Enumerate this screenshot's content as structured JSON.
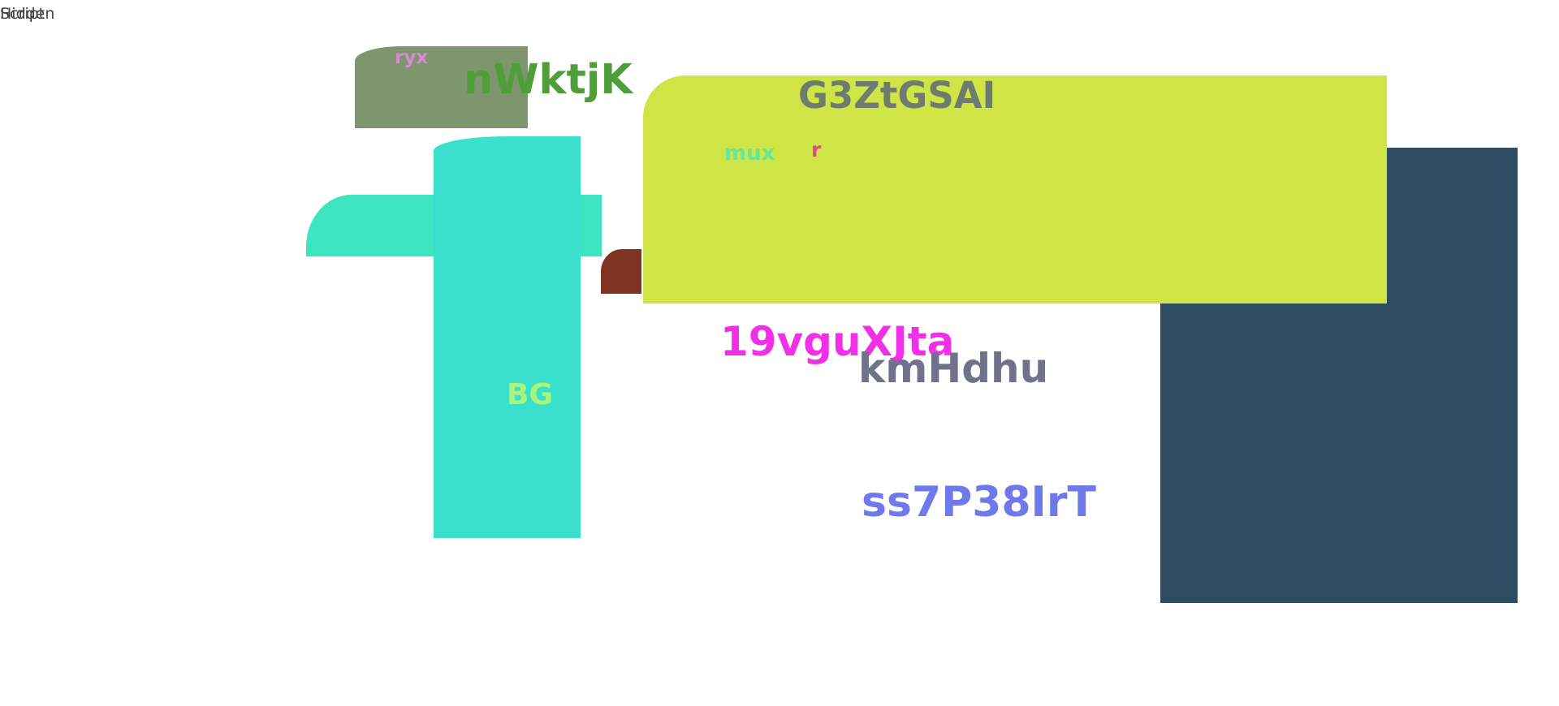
{
  "corner_labels": [
    "Hidden",
    "Script"
  ],
  "shapes": [
    {
      "name": "olive-block",
      "color": "#7e966d"
    },
    {
      "name": "mint-block",
      "color": "#3de4c0"
    },
    {
      "name": "teal-column",
      "color": "#3be0cc"
    },
    {
      "name": "brown-block",
      "color": "#7f3322"
    },
    {
      "name": "navy-block",
      "color": "#2d4b61"
    },
    {
      "name": "lime-panel",
      "color": "#cfe545"
    }
  ],
  "labels": {
    "ryx": "ryx",
    "nwktjk": "nWktjK",
    "g3ztgsai": "G3ZtGSAI",
    "mux": "mux",
    "r": "r",
    "bg": "BG",
    "vgu": "19vguXJta",
    "kmhdhu": "kmHdhu",
    "ss7": "ss7P38IrT"
  },
  "colors": {
    "ryx": "#d98ad6",
    "nwktjk": "#4f9e3a",
    "g3ztgsai": "#6e7b6e",
    "mux": "#5ee8a0",
    "r": "#d94b88",
    "bg": "#a8f57a",
    "vgu": "#f02fe6",
    "kmhdhu": "#70718a",
    "ss7": "#6f79ea"
  }
}
